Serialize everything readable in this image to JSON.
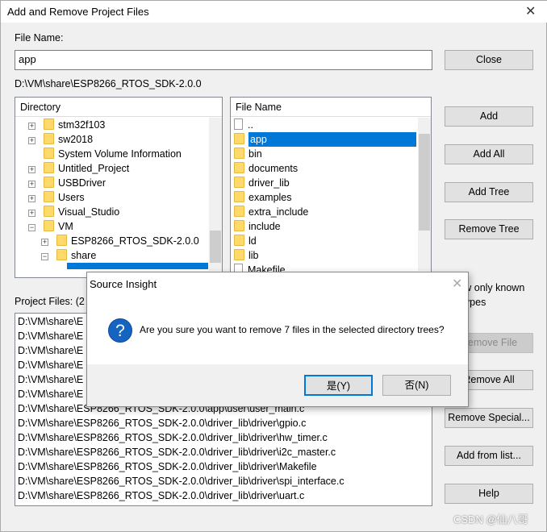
{
  "window": {
    "title": "Add and Remove Project Files",
    "close_icon": "close-icon"
  },
  "file_name": {
    "label": "File Name:",
    "value": "app"
  },
  "current_path": "D:\\VM\\share\\ESP8266_RTOS_SDK-2.0.0",
  "directory": {
    "header": "Directory",
    "items": [
      {
        "label": "stm32f103",
        "expander": "+",
        "indent": 0
      },
      {
        "label": "sw2018",
        "expander": "+",
        "indent": 0
      },
      {
        "label": "System Volume Information",
        "expander": "",
        "indent": 0
      },
      {
        "label": "Untitled_Project",
        "expander": "+",
        "indent": 0
      },
      {
        "label": "USBDriver",
        "expander": "+",
        "indent": 0
      },
      {
        "label": "Users",
        "expander": "+",
        "indent": 0
      },
      {
        "label": "Visual_Studio",
        "expander": "+",
        "indent": 0
      },
      {
        "label": "VM",
        "expander": "−",
        "indent": 0
      },
      {
        "label": "ESP8266_RTOS_SDK-2.0.0",
        "expander": "+",
        "indent": 1
      },
      {
        "label": "share",
        "expander": "−",
        "indent": 1
      }
    ]
  },
  "files": {
    "header": "File Name",
    "items": [
      {
        "label": "..",
        "type": "file"
      },
      {
        "label": "app",
        "type": "folder",
        "selected": true
      },
      {
        "label": "bin",
        "type": "folder"
      },
      {
        "label": "documents",
        "type": "folder"
      },
      {
        "label": "driver_lib",
        "type": "folder"
      },
      {
        "label": "examples",
        "type": "folder"
      },
      {
        "label": "extra_include",
        "type": "folder"
      },
      {
        "label": "include",
        "type": "folder"
      },
      {
        "label": "ld",
        "type": "folder"
      },
      {
        "label": "lib",
        "type": "folder"
      },
      {
        "label": "Makefile",
        "type": "file"
      }
    ]
  },
  "buttons": {
    "close": "Close",
    "add": "Add",
    "add_all": "Add All",
    "add_tree": "Add Tree",
    "remove_tree": "Remove Tree",
    "remove_file": "Remove File",
    "remove_all": "Remove All",
    "remove_special": "Remove Special...",
    "add_from_list": "Add from list...",
    "help": "Help"
  },
  "show_known_types": "Show only known file types",
  "project_files": {
    "label": "Project Files: (2",
    "items": [
      "D:\\VM\\share\\E",
      "D:\\VM\\share\\E",
      "D:\\VM\\share\\E",
      "D:\\VM\\share\\E",
      "D:\\VM\\share\\E",
      "D:\\VM\\share\\E",
      "D:\\VM\\share\\ESP8266_RTOS_SDK-2.0.0\\app\\user\\user_main.c",
      "D:\\VM\\share\\ESP8266_RTOS_SDK-2.0.0\\driver_lib\\driver\\gpio.c",
      "D:\\VM\\share\\ESP8266_RTOS_SDK-2.0.0\\driver_lib\\driver\\hw_timer.c",
      "D:\\VM\\share\\ESP8266_RTOS_SDK-2.0.0\\driver_lib\\driver\\i2c_master.c",
      "D:\\VM\\share\\ESP8266_RTOS_SDK-2.0.0\\driver_lib\\driver\\Makefile",
      "D:\\VM\\share\\ESP8266_RTOS_SDK-2.0.0\\driver_lib\\driver\\spi_interface.c",
      "D:\\VM\\share\\ESP8266_RTOS_SDK-2.0.0\\driver_lib\\driver\\uart.c"
    ]
  },
  "message_box": {
    "title": "Source Insight",
    "text": "Are you sure you want to remove 7 files in the selected directory trees?",
    "yes": "是(Y)",
    "no": "否(N)",
    "icon": "question-icon"
  },
  "watermark": "CSDN @仙八哥",
  "colors": {
    "selection": "#0078d7",
    "folder": "#ffd96a"
  }
}
